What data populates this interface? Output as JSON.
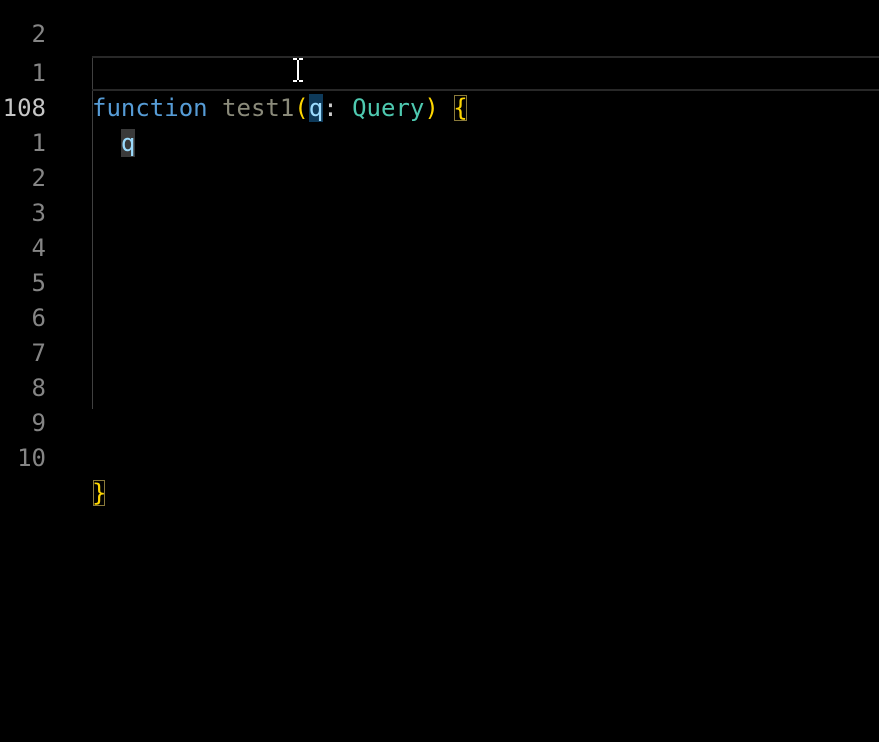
{
  "editor": {
    "gutter": {
      "top_partial": "2",
      "lines": [
        "1",
        "108",
        "1",
        "2",
        "3",
        "4",
        "5",
        "6",
        "7",
        "8",
        "9",
        "10"
      ]
    },
    "code": {
      "line1": {
        "keyword": "function",
        "name": "test1",
        "open_paren": "(",
        "param": "q",
        "colon": ":",
        "type": "Query",
        "close_paren": ")",
        "open_brace": "{"
      },
      "line2": {
        "word": "q"
      },
      "closing_brace": "}"
    },
    "cursor_icon": "i-beam-cursor-icon",
    "colors": {
      "keyword": "#569cd6",
      "bracket": "#ffd700",
      "param": "#9cdcfe",
      "type": "#4ec9b0",
      "param_highlight": "#0e3a5a"
    }
  }
}
